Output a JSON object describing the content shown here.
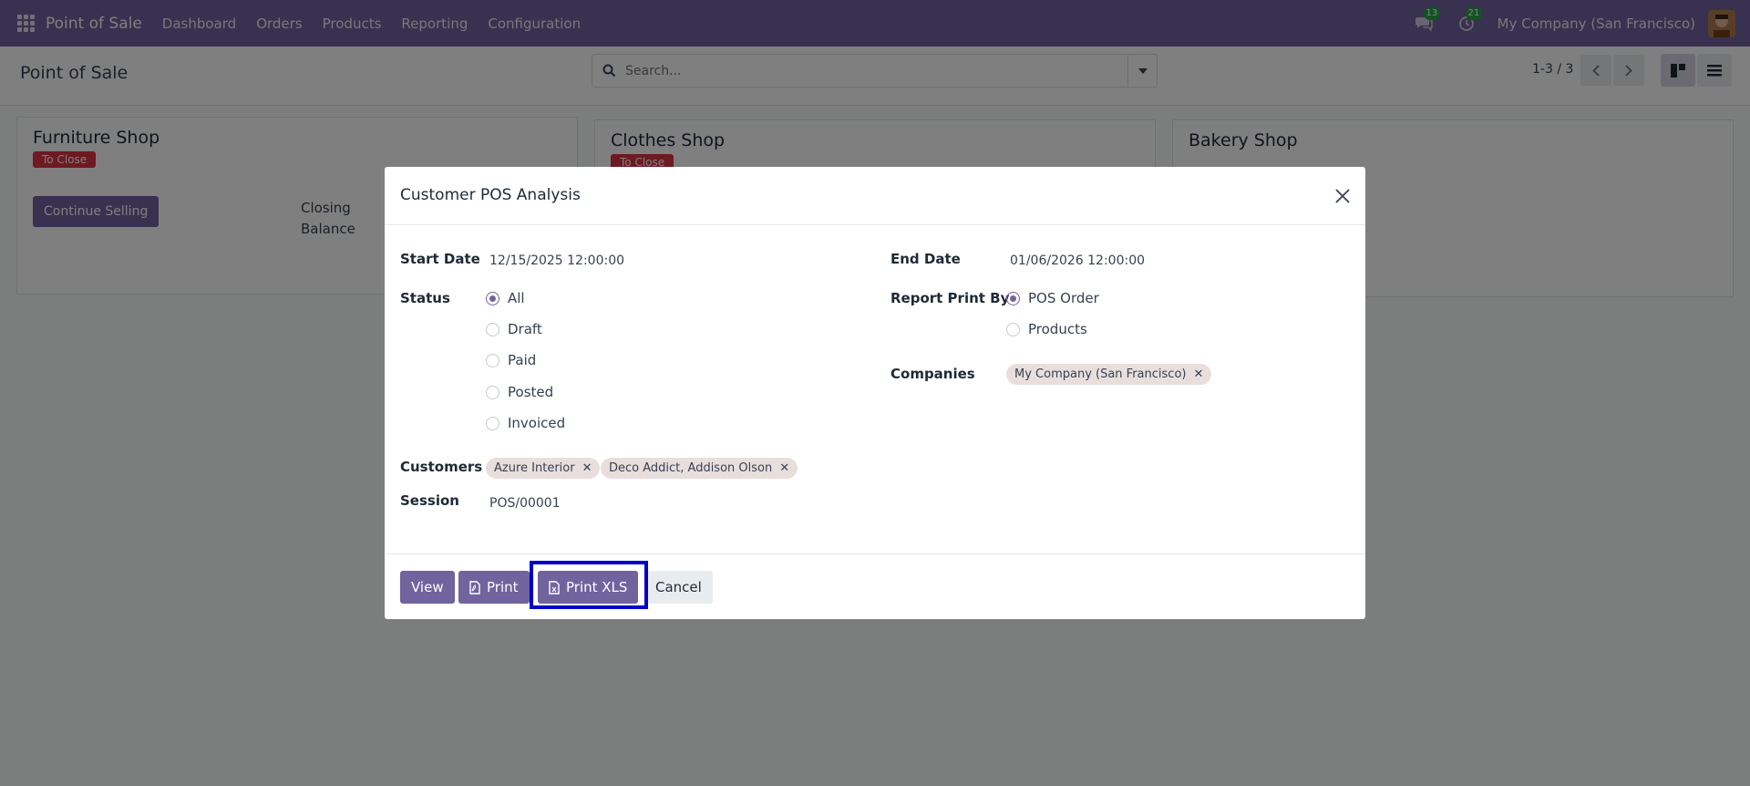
{
  "navbar": {
    "app_name": "Point of Sale",
    "menu": [
      "Dashboard",
      "Orders",
      "Products",
      "Reporting",
      "Configuration"
    ],
    "messages_count": "13",
    "activities_count": "21",
    "company": "My Company (San Francisco)"
  },
  "control": {
    "title": "Point of Sale",
    "search_placeholder": "Search...",
    "pager": "1-3 / 3"
  },
  "cards": [
    {
      "title": "Furniture Shop",
      "tag": "To Close",
      "button": "Continue Selling",
      "closing_label_1": "Closing",
      "closing_label_2": "Balance"
    },
    {
      "title": "Clothes Shop",
      "tag": "To Close"
    },
    {
      "title": "Bakery Shop"
    }
  ],
  "modal": {
    "title": "Customer POS Analysis",
    "start_date_label": "Start Date",
    "start_date": "12/15/2025 12:00:00",
    "end_date_label": "End Date",
    "end_date": "01/06/2026 12:00:00",
    "status_label": "Status",
    "status_options": [
      "All",
      "Draft",
      "Paid",
      "Posted",
      "Invoiced"
    ],
    "status_selected": "All",
    "print_by_label": "Report Print By",
    "print_by_options": [
      "POS Order",
      "Products"
    ],
    "print_by_selected": "POS Order",
    "companies_label": "Companies",
    "companies": [
      "My Company (San Francisco)"
    ],
    "customers_label": "Customers",
    "customers": [
      "Azure Interior",
      "Deco Addict, Addison Olson"
    ],
    "session_label": "Session",
    "session": "POS/00001",
    "buttons": {
      "view": "View",
      "print": "Print",
      "print_xls": "Print XLS",
      "cancel": "Cancel"
    }
  },
  "colors": {
    "brand": "#71639e",
    "danger": "#dc3545",
    "highlight": "#0000c8"
  }
}
